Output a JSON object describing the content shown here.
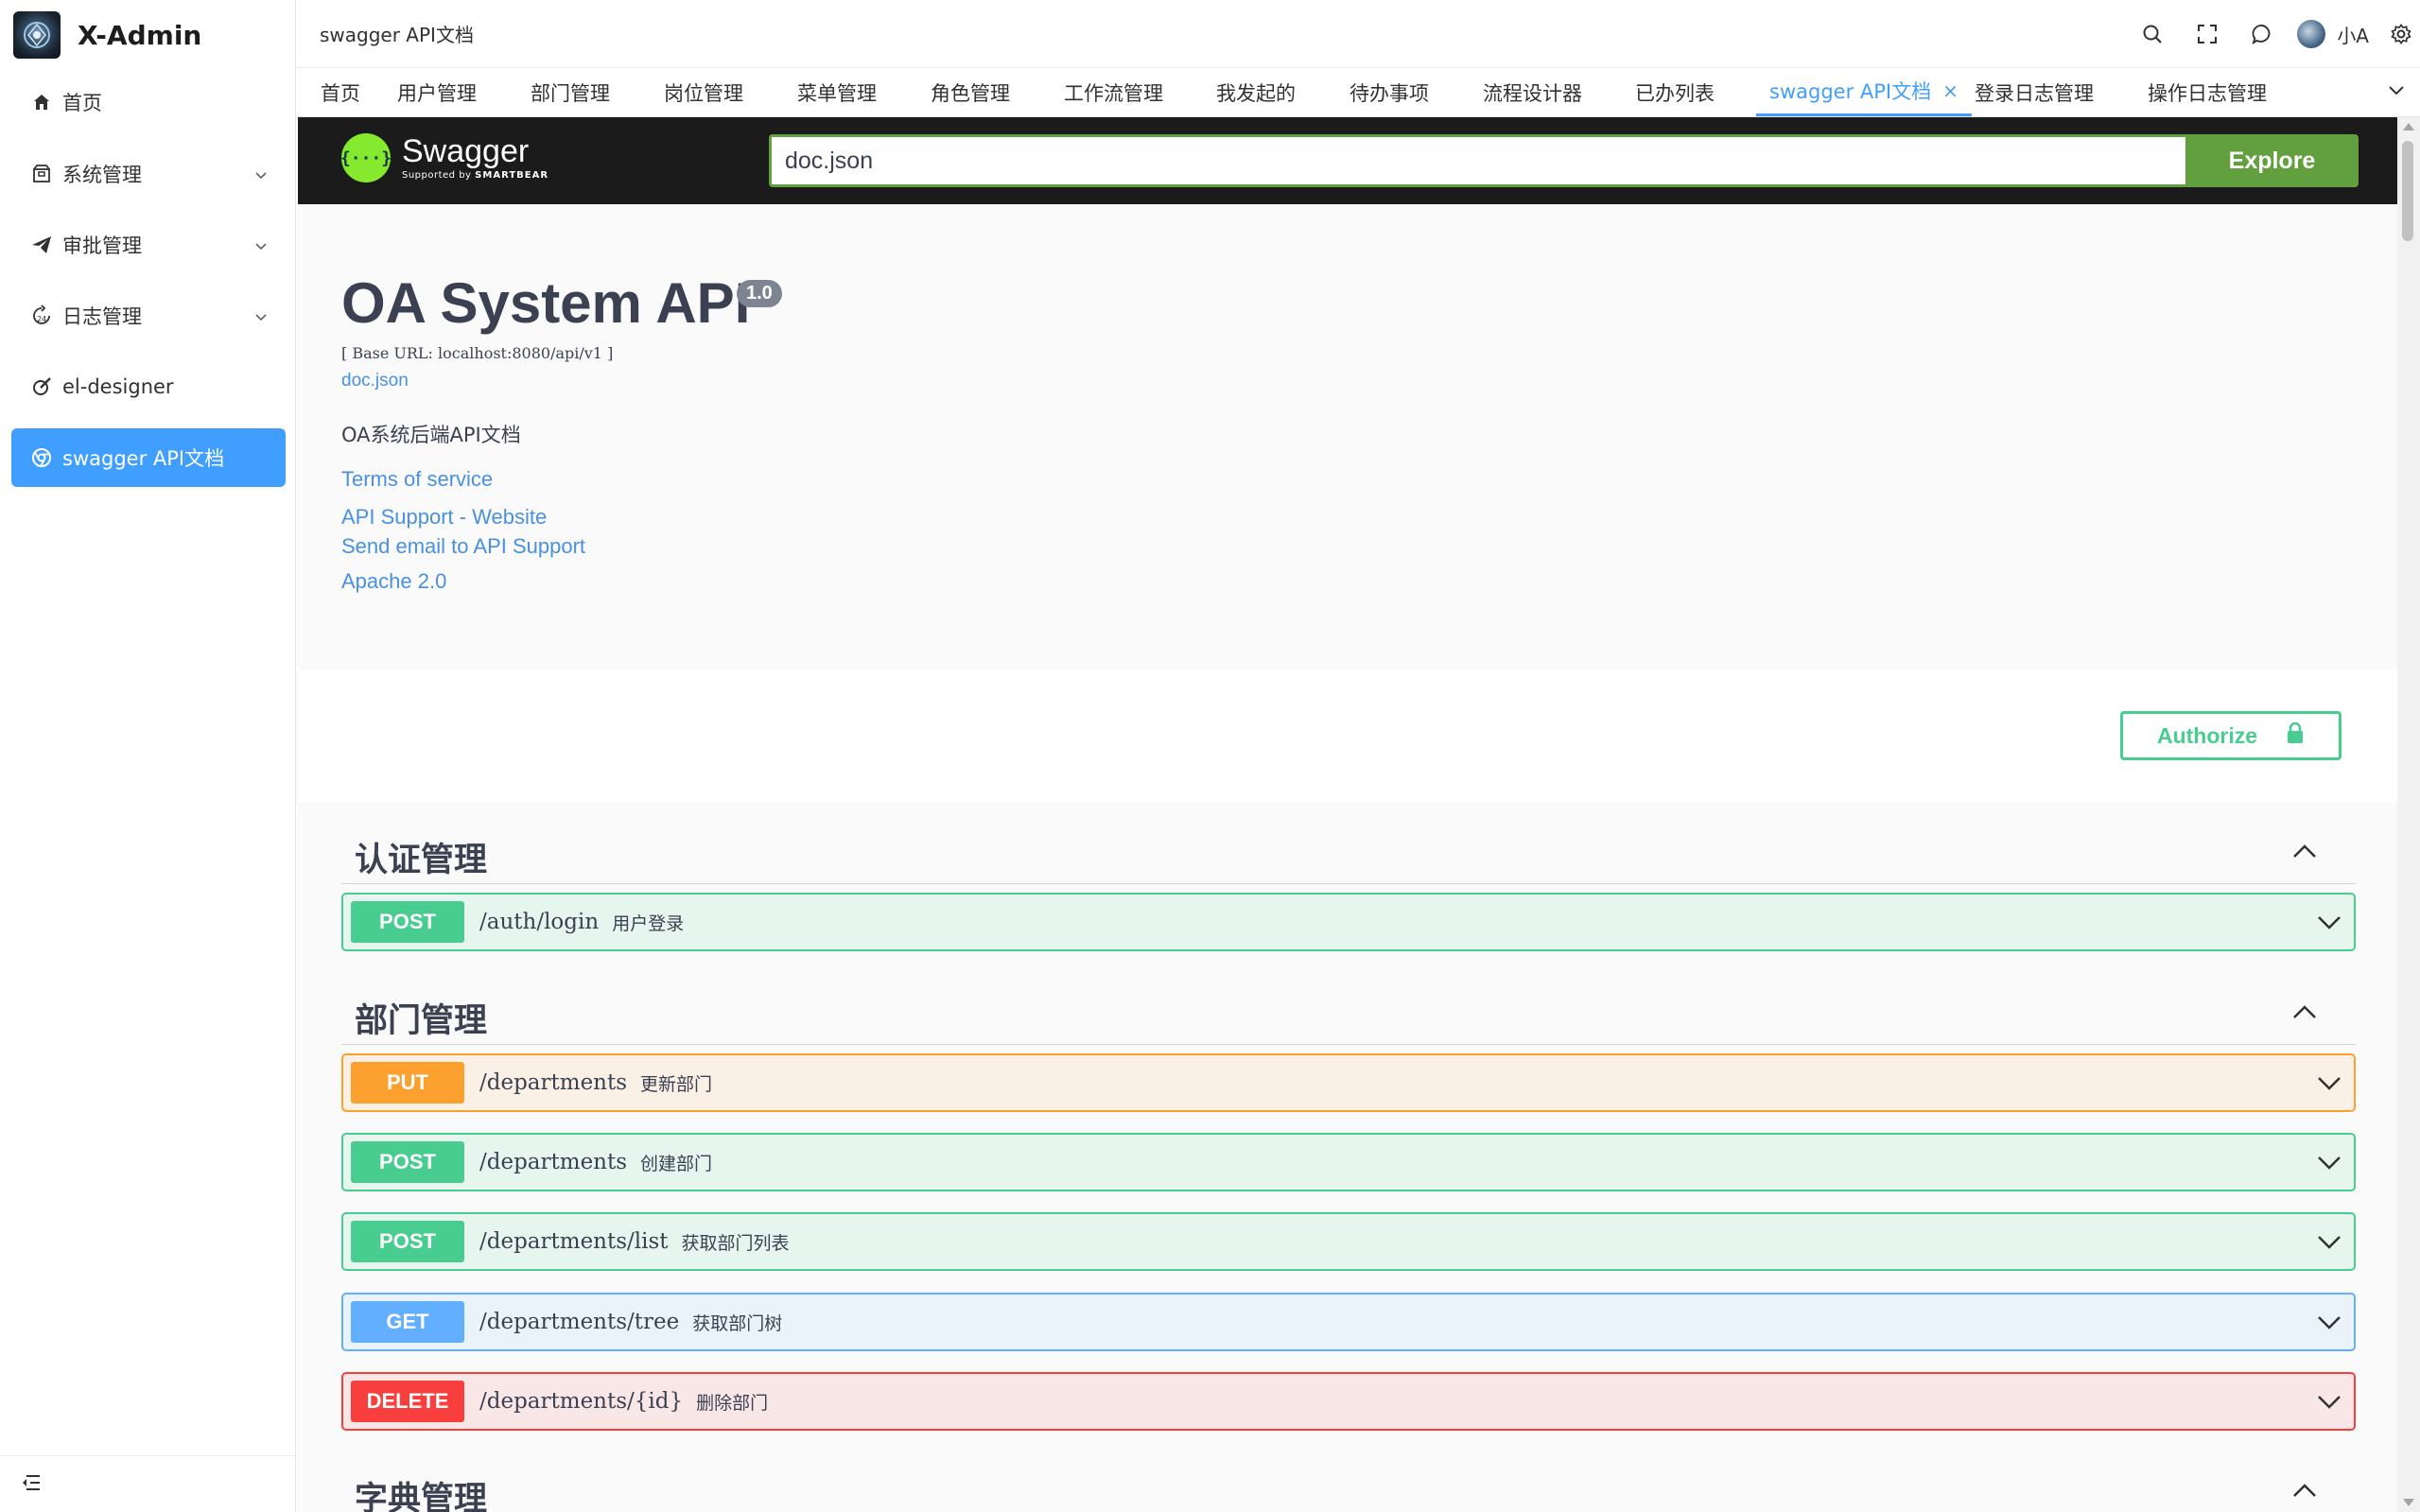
{
  "app": {
    "title": "X-Admin"
  },
  "sidebar": {
    "items": [
      {
        "label": "首页",
        "icon": "home-icon"
      },
      {
        "label": "系统管理",
        "icon": "package-icon",
        "expandable": true
      },
      {
        "label": "审批管理",
        "icon": "send-icon",
        "expandable": true
      },
      {
        "label": "日志管理",
        "icon": "history-icon",
        "expandable": true
      },
      {
        "label": "el-designer",
        "icon": "edit-icon"
      },
      {
        "label": "swagger API文档",
        "icon": "chrome-icon",
        "active": true
      }
    ],
    "collapse_icon": "menu-fold-icon"
  },
  "header": {
    "breadcrumb": "swagger API文档",
    "icons": [
      "search-icon",
      "fullscreen-icon",
      "message-icon",
      "settings-icon"
    ],
    "user_name": "小A"
  },
  "tabs": [
    {
      "label": "首页"
    },
    {
      "label": "用户管理"
    },
    {
      "label": "部门管理"
    },
    {
      "label": "岗位管理"
    },
    {
      "label": "菜单管理"
    },
    {
      "label": "角色管理"
    },
    {
      "label": "工作流管理"
    },
    {
      "label": "我发起的"
    },
    {
      "label": "待办事项"
    },
    {
      "label": "流程设计器"
    },
    {
      "label": "已办列表"
    },
    {
      "label": "swagger API文档",
      "active": true,
      "closable": true
    },
    {
      "label": "登录日志管理"
    },
    {
      "label": "操作日志管理"
    }
  ],
  "swagger": {
    "brand": "Swagger",
    "supported_by": "Supported by",
    "smartbear": "SMARTBEAR",
    "url_value": "doc.json",
    "explore_label": "Explore",
    "info": {
      "title": "OA System API",
      "version": "1.0",
      "base_url": "[ Base URL: localhost:8080/api/v1 ]",
      "doc_link": "doc.json",
      "description": "OA系统后端API文档",
      "terms": "Terms of service",
      "support_website": "API Support - Website",
      "support_email": "Send email to API Support",
      "license": "Apache 2.0"
    },
    "authorize_label": "Authorize",
    "tags": [
      {
        "name": "认证管理",
        "operations": [
          {
            "method": "POST",
            "path": "/auth/login",
            "summary": "用户登录"
          }
        ]
      },
      {
        "name": "部门管理",
        "operations": [
          {
            "method": "PUT",
            "path": "/departments",
            "summary": "更新部门"
          },
          {
            "method": "POST",
            "path": "/departments",
            "summary": "创建部门"
          },
          {
            "method": "POST",
            "path": "/departments/list",
            "summary": "获取部门列表"
          },
          {
            "method": "GET",
            "path": "/departments/tree",
            "summary": "获取部门树"
          },
          {
            "method": "DELETE",
            "path": "/departments/{id}",
            "summary": "删除部门"
          }
        ]
      },
      {
        "name": "字典管理",
        "operations": []
      }
    ]
  },
  "colors": {
    "accent": "#409eff",
    "swagger_green": "#62a03f",
    "post": "#49cc90",
    "put": "#fca130",
    "get": "#61affe",
    "delete": "#f93e3e"
  }
}
